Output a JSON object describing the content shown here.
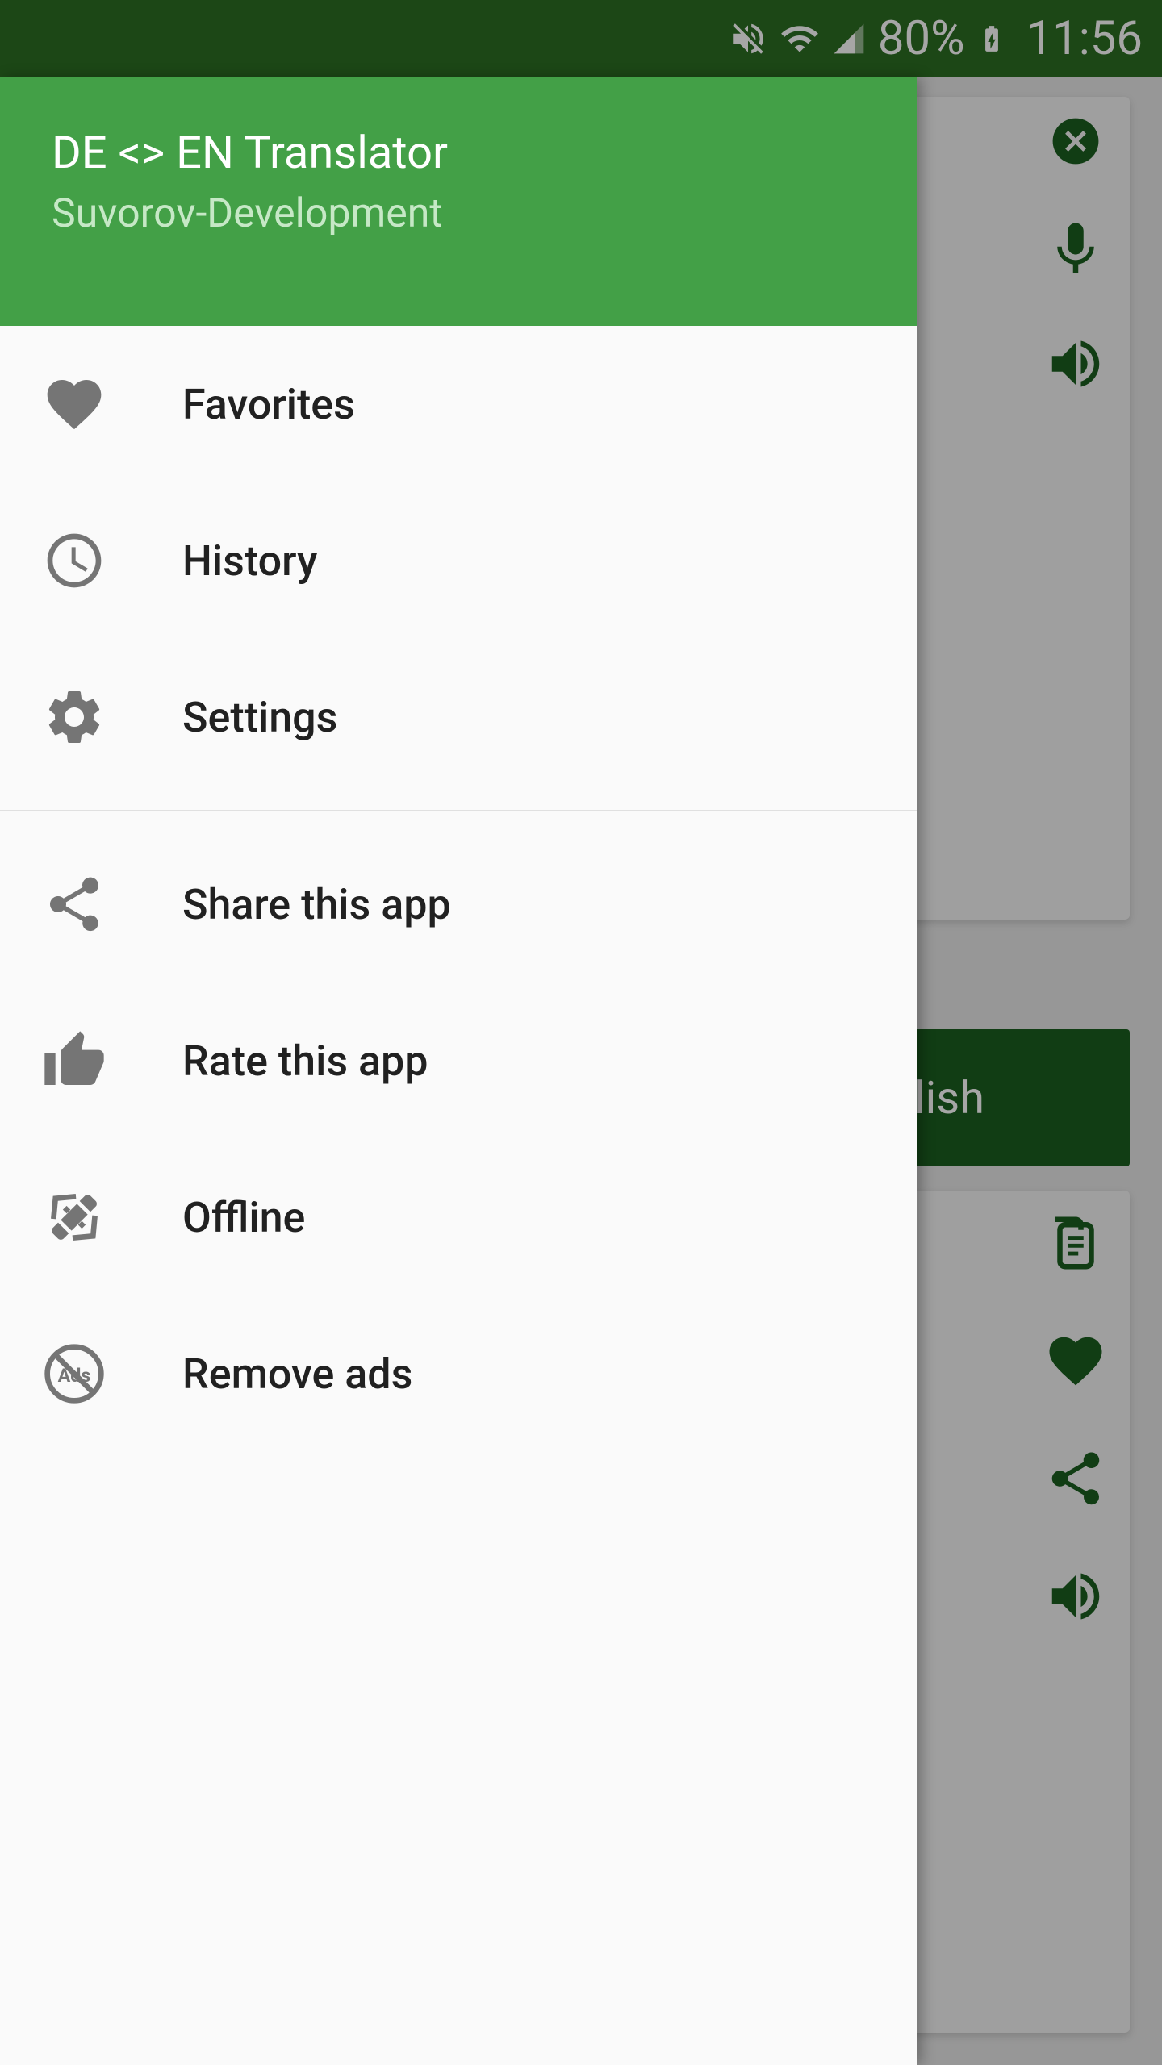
{
  "status": {
    "battery": "80%",
    "time": "11:56"
  },
  "colors": {
    "status_bar": "#2b6e23",
    "drawer_header": "#43a047",
    "accent": "#1b5e20",
    "inactive": "#757575"
  },
  "drawer": {
    "title": "DE <> EN Translator",
    "subtitle": "Suvorov-Development",
    "primary_items": [
      {
        "icon": "heart-icon",
        "label": "Favorites"
      },
      {
        "icon": "clock-icon",
        "label": "History"
      },
      {
        "icon": "gear-icon",
        "label": "Settings"
      }
    ],
    "secondary_items": [
      {
        "icon": "share-icon",
        "label": "Share this app"
      },
      {
        "icon": "thumbs-up-icon",
        "label": "Rate this app"
      },
      {
        "icon": "plug-icon",
        "label": "Offline"
      },
      {
        "icon": "no-ads-icon",
        "label": "Remove ads"
      }
    ]
  },
  "background": {
    "translate_button_visible_text": "lish",
    "top_card_icons": [
      "close-icon",
      "microphone-icon",
      "speaker-icon"
    ],
    "bottom_card_icons": [
      "copy-icon",
      "heart-icon",
      "share-icon",
      "speaker-icon"
    ]
  }
}
